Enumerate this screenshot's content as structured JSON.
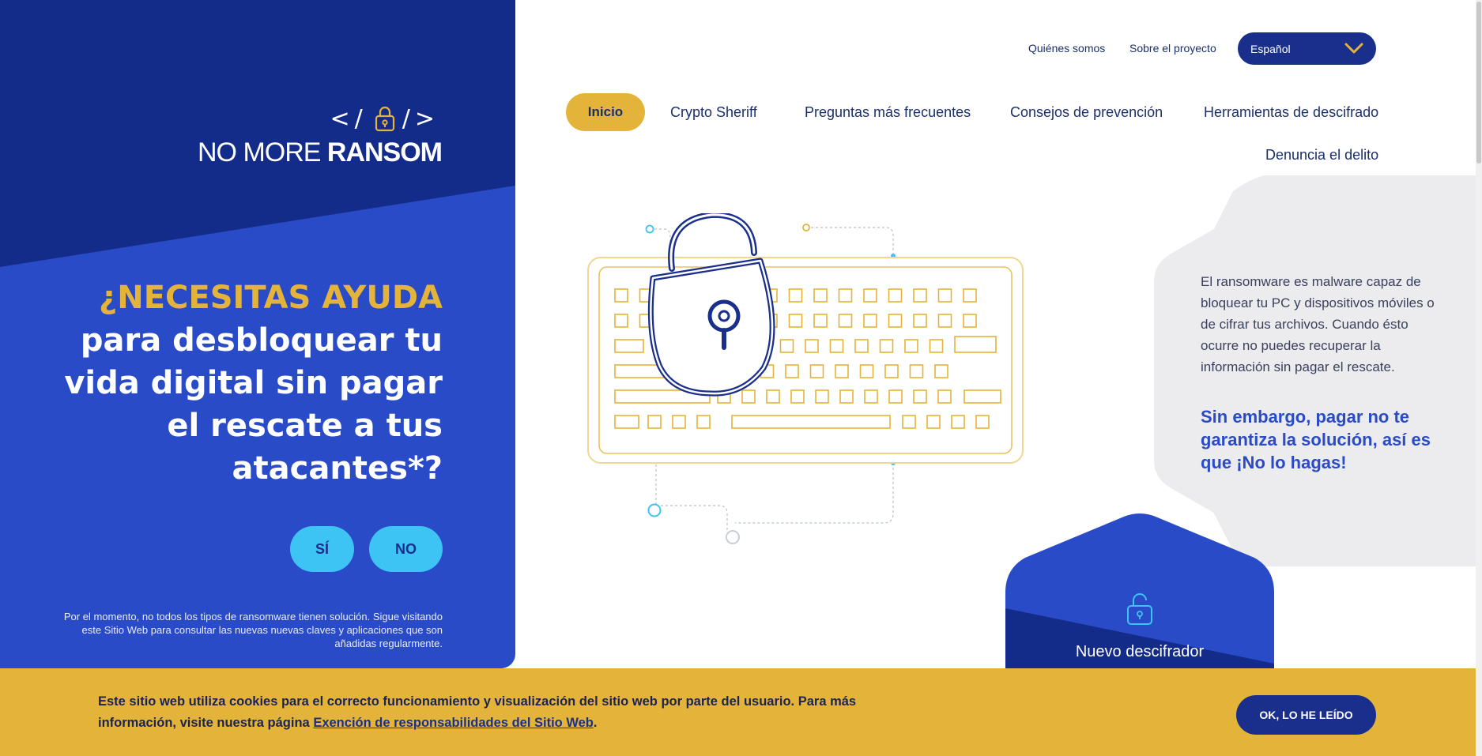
{
  "brand": {
    "code_left": "</",
    "code_right": "/>",
    "word_no": "NO",
    "word_more": "MORE",
    "word_ransom": "RANSOM"
  },
  "colors": {
    "navy": "#132c8a",
    "blue": "#2a4bc7",
    "yellow": "#e4b43a",
    "cyan": "#3ec3f5",
    "grey_hex": "#ececee"
  },
  "utility_nav": {
    "quienes": "Quiénes somos",
    "sobre": "Sobre el proyecto",
    "language": "Español"
  },
  "main_nav": {
    "inicio": "Inicio",
    "crypto": "Crypto Sheriff",
    "preguntas": "Preguntas más frecuentes",
    "consejos": "Consejos de prevención",
    "herramientas": "Herramientas de descifrado",
    "denuncia": "Denuncia el delito"
  },
  "hero": {
    "accent": "¿NECESITAS AYUDA",
    "rest": "para desbloquear tu vida digital sin pagar el rescate a tus atacantes*?",
    "yes": "SÍ",
    "no": "NO",
    "note": "Por el momento, no todos los tipos de ransomware tienen solución. Sigue visitando este Sitio Web para consultar las nuevas nuevas claves y aplicaciones que son añadidas regularmente."
  },
  "info": {
    "text": "El ransomware es malware capaz de bloquear tu PC y dispositivos móviles o de cifrar tus archivos. Cuando ésto ocurre no puedes recuperar la información sin pagar el rescate.",
    "highlight": "Sin embargo, pagar no te garantiza la solución, así es que ¡No lo hagas!"
  },
  "card": {
    "label": "Nuevo descifrador"
  },
  "cookie": {
    "text_before": "Este sitio web utiliza cookies para el correcto funcionamiento y visualización del sitio web por parte del usuario. Para más información, visite nuestra página ",
    "link": "Exención de responsabilidades del Sitio Web",
    "text_after": ".",
    "ok": "OK, LO HE LEÍDO"
  }
}
